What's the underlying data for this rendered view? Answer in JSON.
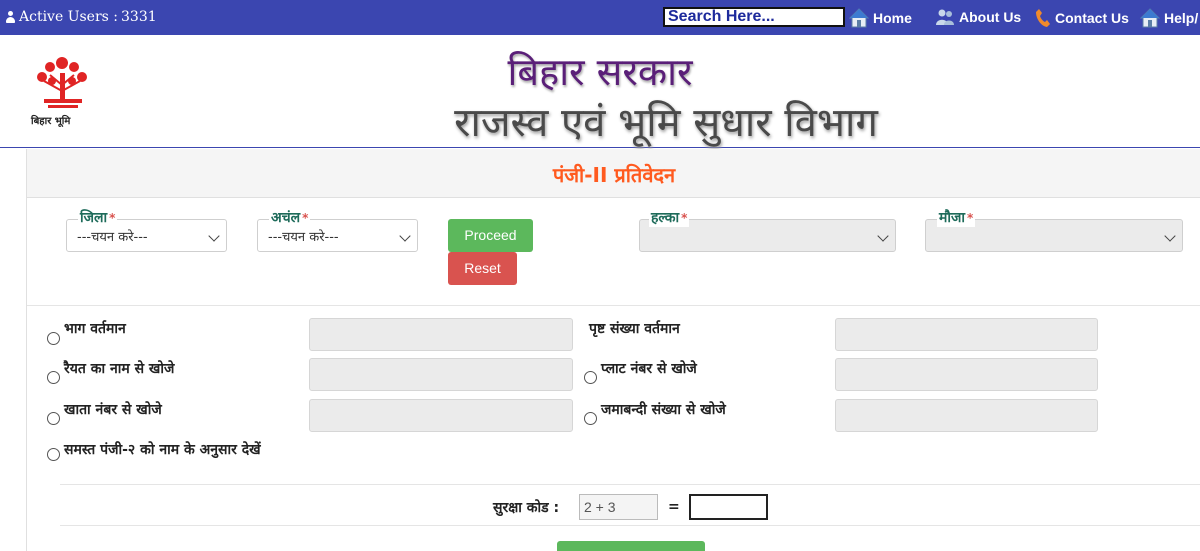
{
  "topbar": {
    "active_users_label": "Active Users :",
    "active_users_count": "3331",
    "search_placeholder": "Search Here...",
    "nav": {
      "home": "Home",
      "about": "About Us",
      "contact": "Contact Us",
      "help": "Help/"
    }
  },
  "header": {
    "logo_caption": "बिहार भूमि",
    "government": "बिहार सरकार",
    "department": "राजस्व एवं भूमि सुधार विभाग"
  },
  "report": {
    "title": "पंजी-II प्रतिवेदन",
    "filters": {
      "district_label": "जिला",
      "district_value": "---चयन करे---",
      "circle_label": "अचंल",
      "circle_value": "---चयन करे---",
      "halka_label": "हल्का",
      "halka_value": "",
      "mauza_label": "मौजा",
      "mauza_value": "",
      "required_mark": "*"
    },
    "buttons": {
      "proceed": "Proceed",
      "reset": "Reset"
    },
    "search_options": {
      "bhag_current": "भाग वर्तमान",
      "page_number_current": "पृष्ट संख्या वर्तमान",
      "by_raiyat_name": "रैयत का नाम से खोजे",
      "by_plot_number": "प्लाट नंबर से खोजे",
      "by_khata_number": "खाता नंबर से खोजे",
      "by_jamabandi_number": "जमाबन्दी संख्या से खोजे",
      "all_by_name": "समस्त पंजी-२ को नाम के अनुसार देखें"
    },
    "captcha": {
      "label": "सुरक्षा कोड :",
      "question": "2 + 3",
      "equals": "="
    }
  },
  "colors": {
    "topbar": "#3b46b0",
    "title_orange": "#ff5a1f",
    "label_teal": "#1e6b5a",
    "proceed_green": "#5cb85c",
    "reset_red": "#d9534f"
  }
}
